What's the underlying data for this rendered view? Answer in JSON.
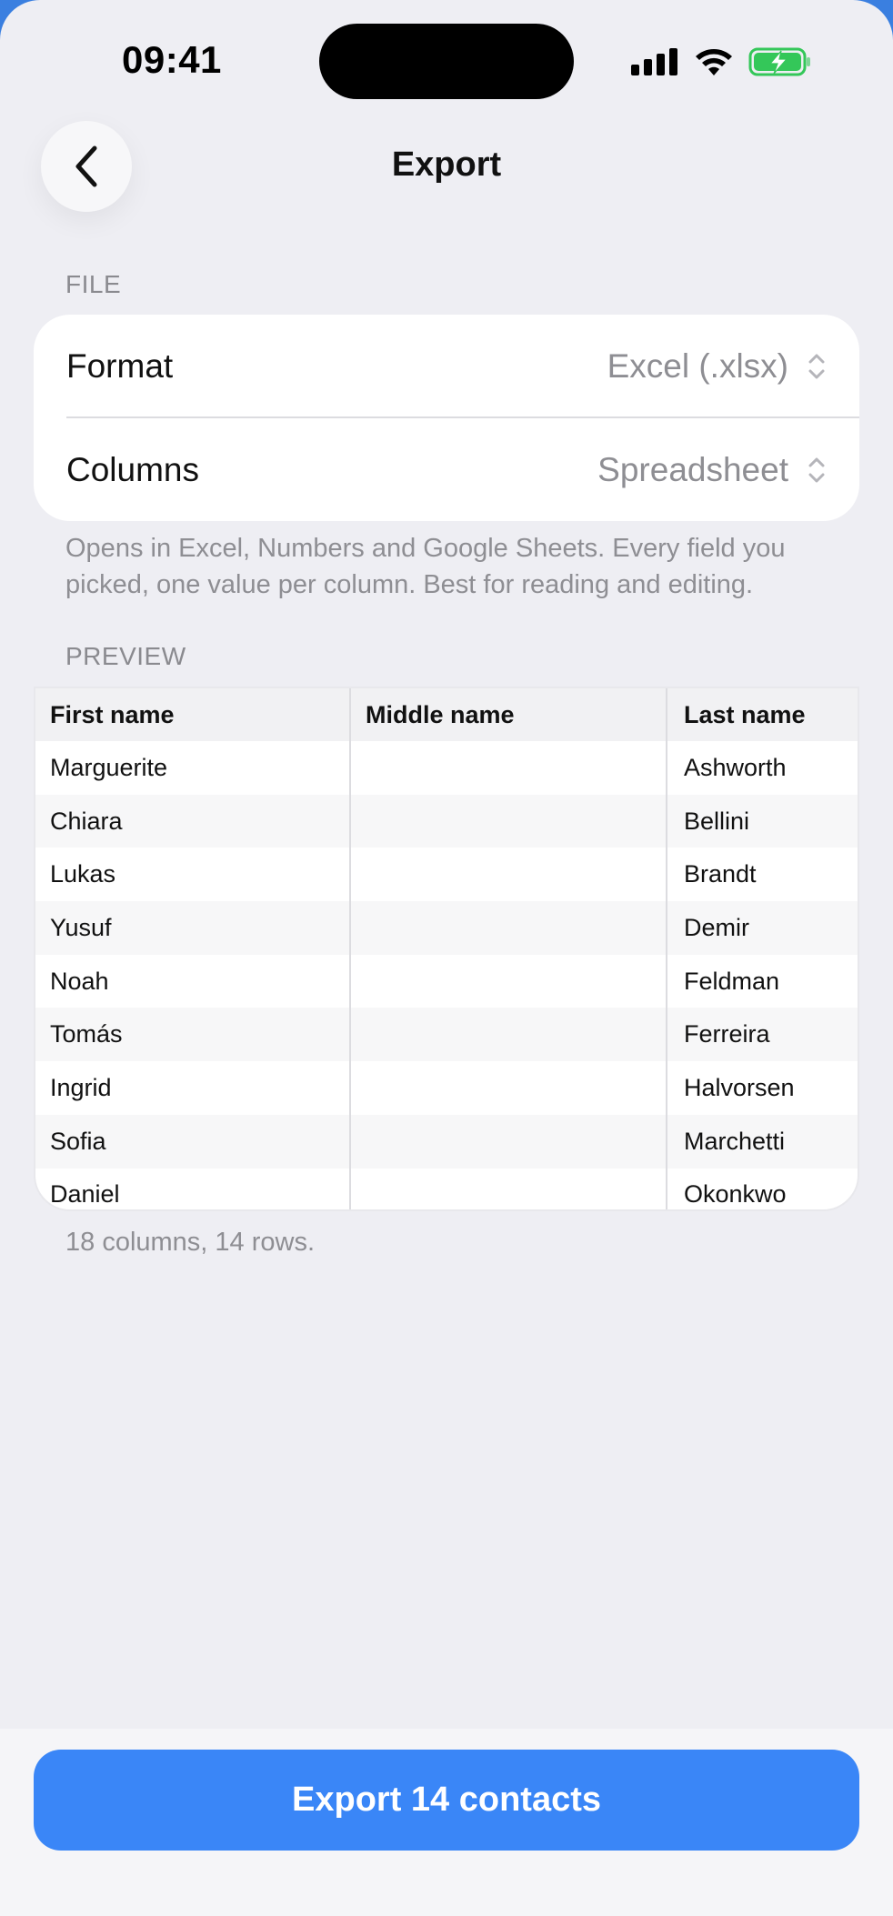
{
  "status_bar": {
    "time": "09:41"
  },
  "nav": {
    "title": "Export",
    "back_icon": "chevron-left-icon"
  },
  "file_section": {
    "label": "FILE",
    "rows": [
      {
        "label": "Format",
        "value": "Excel (.xlsx)"
      },
      {
        "label": "Columns",
        "value": "Spreadsheet"
      }
    ],
    "hint": "Opens in Excel, Numbers and Google Sheets. Every field you picked, one value per column. Best for reading and editing."
  },
  "preview_section": {
    "label": "PREVIEW",
    "headers": [
      "First name",
      "Middle name",
      "Last name"
    ],
    "rows": [
      [
        "Marguerite",
        "",
        "Ashworth"
      ],
      [
        "Chiara",
        "",
        "Bellini"
      ],
      [
        "Lukas",
        "",
        "Brandt"
      ],
      [
        "Yusuf",
        "",
        "Demir"
      ],
      [
        "Noah",
        "",
        "Feldman"
      ],
      [
        "Tomás",
        "",
        "Ferreira"
      ],
      [
        "Ingrid",
        "",
        "Halvorsen"
      ],
      [
        "Sofia",
        "",
        "Marchetti"
      ],
      [
        "Daniel",
        "",
        "Okonkwo"
      ]
    ],
    "caption": "18 columns, 14 rows."
  },
  "footer": {
    "export_label": "Export 14 contacts"
  },
  "colors": {
    "accent": "#3a86f7",
    "background": "#eeeef3",
    "battery": "#34c759"
  }
}
